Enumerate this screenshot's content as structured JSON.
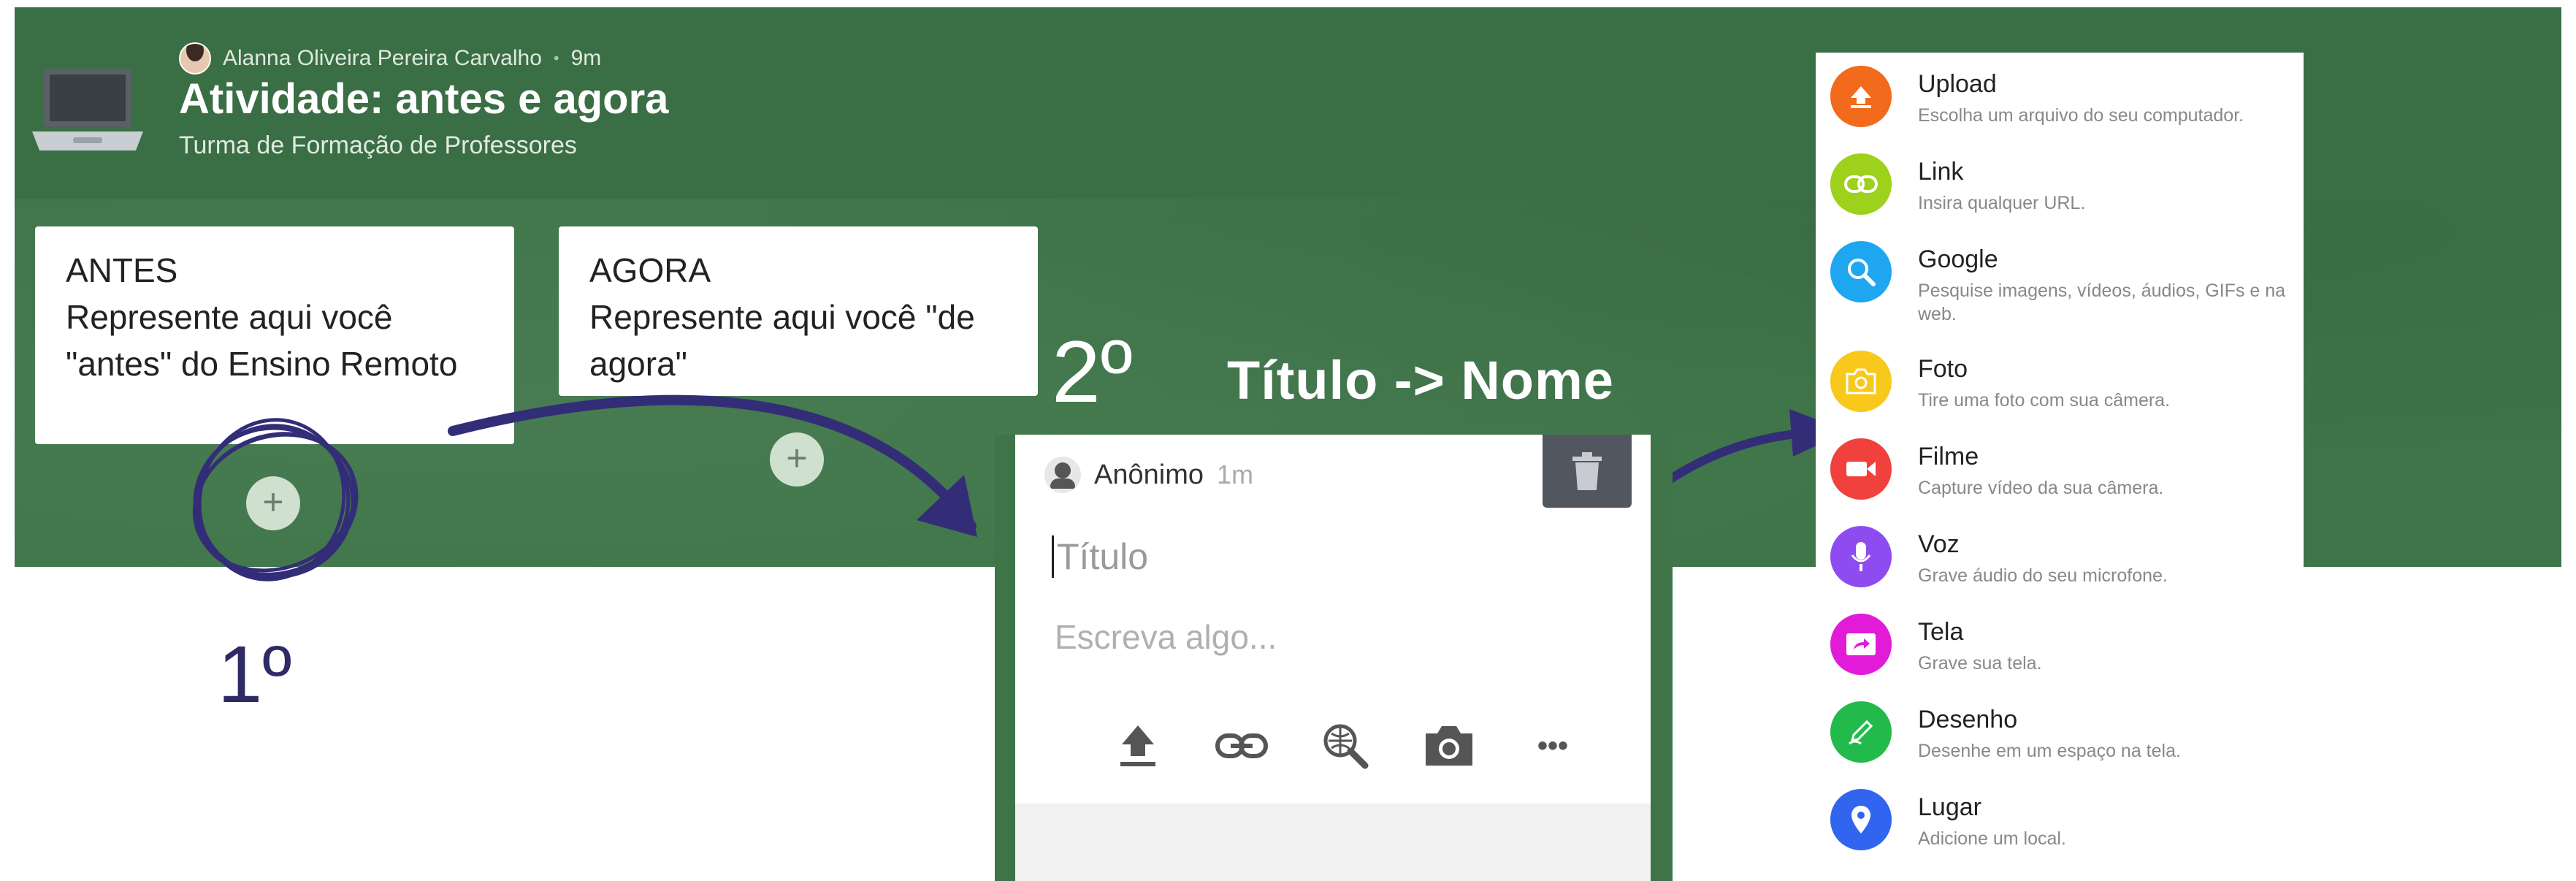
{
  "header": {
    "author": "Alanna Oliveira Pereira Carvalho",
    "separator": "•",
    "time": "9m",
    "title": "Atividade: antes e agora",
    "subtitle": "Turma de Formação de Professores"
  },
  "columns": [
    {
      "label": "ANTES",
      "description": "Represente aqui você \"antes\" do Ensino Remoto",
      "add_icon": "+"
    },
    {
      "label": "AGORA",
      "description": "Represente aqui você \"de agora\"",
      "add_icon": "+"
    }
  ],
  "annotations": {
    "step1": "1º",
    "step2": "2º",
    "step2_caption": "Título -> Nome",
    "accent_color": "#2e2a66"
  },
  "editor": {
    "author": "Anônimo",
    "time": "1m",
    "title_placeholder": "Título",
    "body_placeholder": "Escreva algo...",
    "tools": [
      "upload-icon",
      "link-icon",
      "search-web-icon",
      "camera-icon",
      "more-icon"
    ],
    "more_label": "•••"
  },
  "attach_menu": {
    "items": [
      {
        "label": "Upload",
        "desc": "Escolha um arquivo do seu computador.",
        "color": "#f26a1b"
      },
      {
        "label": "Link",
        "desc": "Insira qualquer URL.",
        "color": "#9dd11b"
      },
      {
        "label": "Google",
        "desc": "Pesquise imagens, vídeos, áudios, GIFs e na web.",
        "color": "#1ea7f0"
      },
      {
        "label": "Foto",
        "desc": "Tire uma foto com sua câmera.",
        "color": "#f8c81b"
      },
      {
        "label": "Filme",
        "desc": "Capture vídeo da sua câmera.",
        "color": "#f0413d"
      },
      {
        "label": "Voz",
        "desc": "Grave áudio do seu microfone.",
        "color": "#8e4cf0"
      },
      {
        "label": "Tela",
        "desc": "Grave sua tela.",
        "color": "#e21bd9"
      },
      {
        "label": "Desenho",
        "desc": "Desenhe em um espaço na tela.",
        "color": "#22bb4b"
      },
      {
        "label": "Lugar",
        "desc": "Adicione um local.",
        "color": "#3165f0"
      }
    ]
  }
}
